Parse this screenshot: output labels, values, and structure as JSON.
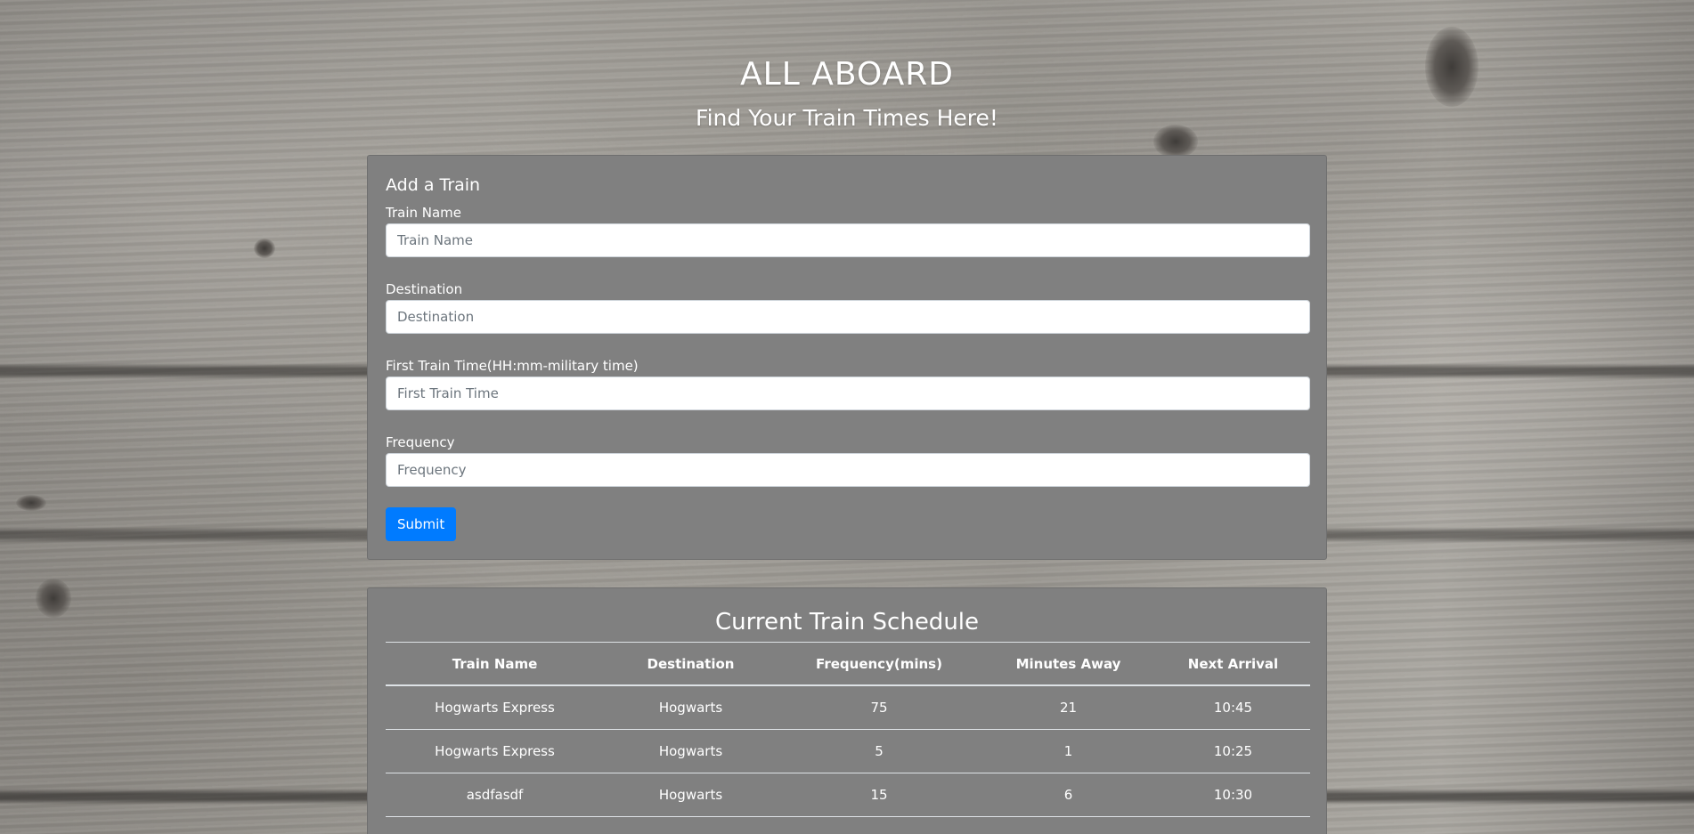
{
  "header": {
    "title": "ALL ABOARD",
    "subtitle": "Find Your Train Times Here!"
  },
  "form": {
    "title": "Add a Train",
    "fields": [
      {
        "label": "Train Name",
        "placeholder": "Train Name",
        "value": ""
      },
      {
        "label": "Destination",
        "placeholder": "Destination",
        "value": ""
      },
      {
        "label": "First Train Time(HH:mm-military time)",
        "placeholder": "First Train Time",
        "value": ""
      },
      {
        "label": "Frequency",
        "placeholder": "Frequency",
        "value": ""
      }
    ],
    "submit_label": "Submit",
    "submit_color": "#007bff"
  },
  "schedule": {
    "title": "Current Train Schedule",
    "columns": [
      "Train Name",
      "Destination",
      "Frequency(mins)",
      "Minutes Away",
      "Next Arrival"
    ],
    "rows": [
      [
        "Hogwarts Express",
        "Hogwarts",
        "75",
        "21",
        "10:45"
      ],
      [
        "Hogwarts Express",
        "Hogwarts",
        "5",
        "1",
        "10:25"
      ],
      [
        "asdfasdf",
        "Hogwarts",
        "15",
        "6",
        "10:30"
      ]
    ]
  },
  "colors": {
    "panel": "#808080",
    "text": "#ffffff"
  }
}
